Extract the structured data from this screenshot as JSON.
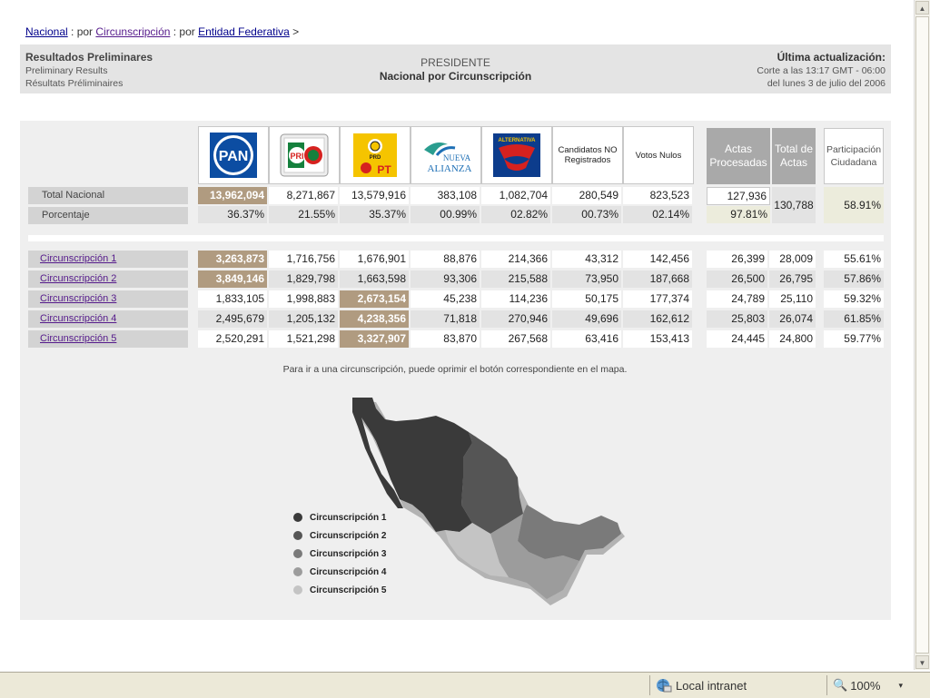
{
  "breadcrumb": {
    "nacional": "Nacional",
    "sep1": " : por ",
    "circunscripcion": "Circunscripción",
    "sep2": " : por ",
    "entidad": "Entidad Federativa",
    "arrow": " >"
  },
  "header": {
    "title_es": "Resultados Preliminares",
    "title_en": "Preliminary Results",
    "title_fr": "Résultats Préliminaires",
    "center_title": "PRESIDENTE",
    "center_subtitle": "Nacional por Circunscripción",
    "update_label": "Última actualización:",
    "update_time": "Corte a las 13:17 GMT - 06:00",
    "update_date": "del lunes 3 de julio del 2006"
  },
  "parties": [
    {
      "name": "PAN",
      "icon": "pan-logo"
    },
    {
      "name": "PRI",
      "icon": "alianza-por-mexico-logo"
    },
    {
      "name": "PRD",
      "icon": "por-el-bien-de-todos-logo"
    },
    {
      "name": "Nueva Alianza",
      "icon": "nueva-alianza-logo"
    },
    {
      "name": "Alternativa",
      "icon": "alternativa-logo"
    },
    {
      "name": "Candidatos NO Registrados",
      "icon": ""
    },
    {
      "name": "Votos Nulos",
      "icon": ""
    }
  ],
  "logo_texts": {
    "nueva_alianza_1": "NUEVA",
    "nueva_alianza_2": "ALIANZA",
    "alternativa": "ALTERNATIVA",
    "pan": "PAN",
    "pri": "PRI",
    "pt": "PT",
    "prd": "PRD"
  },
  "columns": {
    "no_registrados": "Candidatos NO Registrados",
    "nulos": "Votos Nulos",
    "actas_procesadas": "Actas Procesadas",
    "total_actas": "Total de Actas",
    "participacion": "Participación Ciudadana"
  },
  "national": {
    "label": "Total Nacional",
    "values": [
      "13,962,094",
      "8,271,867",
      "13,579,916",
      "383,108",
      "1,082,704",
      "280,549",
      "823,523"
    ],
    "actas_procesadas": "127,936",
    "total_actas": "130,788",
    "participacion": "58.91%"
  },
  "percentage": {
    "label": "Porcentaje",
    "values": [
      "36.37%",
      "21.55%",
      "35.37%",
      "00.99%",
      "02.82%",
      "00.73%",
      "02.14%"
    ],
    "actas_pct": "97.81%"
  },
  "circunscripciones": [
    {
      "label": "Circunscripción 1",
      "values": [
        "3,263,873",
        "1,716,756",
        "1,676,901",
        "88,876",
        "214,366",
        "43,312",
        "142,456"
      ],
      "actas": "26,399",
      "total": "28,009",
      "part": "55.61%",
      "winner": 0
    },
    {
      "label": "Circunscripción 2",
      "values": [
        "3,849,146",
        "1,829,798",
        "1,663,598",
        "93,306",
        "215,588",
        "73,950",
        "187,668"
      ],
      "actas": "26,500",
      "total": "26,795",
      "part": "57.86%",
      "winner": 0
    },
    {
      "label": "Circunscripción 3",
      "values": [
        "1,833,105",
        "1,998,883",
        "2,673,154",
        "45,238",
        "114,236",
        "50,175",
        "177,374"
      ],
      "actas": "24,789",
      "total": "25,110",
      "part": "59.32%",
      "winner": 2
    },
    {
      "label": "Circunscripción 4",
      "values": [
        "2,495,679",
        "1,205,132",
        "4,238,356",
        "71,818",
        "270,946",
        "49,696",
        "162,612"
      ],
      "actas": "25,803",
      "total": "26,074",
      "part": "61.85%",
      "winner": 2
    },
    {
      "label": "Circunscripción 5",
      "values": [
        "2,520,291",
        "1,521,298",
        "3,327,907",
        "83,870",
        "267,568",
        "63,416",
        "153,413"
      ],
      "actas": "24,445",
      "total": "24,800",
      "part": "59.77%",
      "winner": 2
    }
  ],
  "map_note": "Para ir a una circunscripción, puede oprimir el botón correspondiente en el mapa.",
  "legend": [
    {
      "label": "Circunscripción 1",
      "color": "#3a3a3a"
    },
    {
      "label": "Circunscripción 2",
      "color": "#555555"
    },
    {
      "label": "Circunscripción 3",
      "color": "#7a7a7a"
    },
    {
      "label": "Circunscripción 4",
      "color": "#9c9c9c"
    },
    {
      "label": "Circunscripción 5",
      "color": "#c4c4c4"
    }
  ],
  "statusbar": {
    "zone": "Local intranet",
    "zoom": "100%"
  },
  "colors": {
    "highlight": "#b09b80",
    "pan_blue": "#0c4da2",
    "pri_green": "#15803d",
    "prd_yellow": "#f5c400",
    "alternativa_red": "#d6211f"
  }
}
